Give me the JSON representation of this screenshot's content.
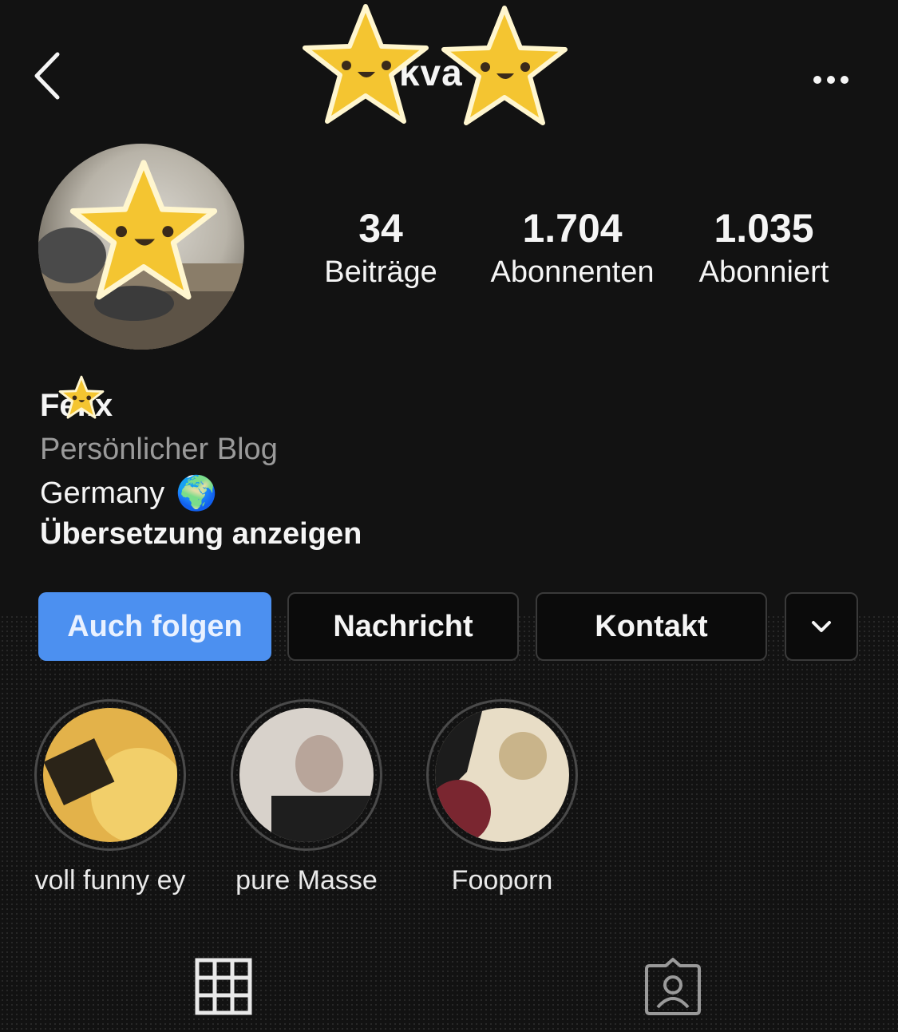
{
  "header": {
    "username": "kva s",
    "back_icon": "chevron-left-icon",
    "more_icon": "ellipsis-icon"
  },
  "stats": [
    {
      "value": "34",
      "label": "Beiträge"
    },
    {
      "value": "1.704",
      "label": "Abonnenten"
    },
    {
      "value": "1.035",
      "label": "Abonniert"
    }
  ],
  "bio": {
    "name": "Felix",
    "category": "Persönlicher Blog",
    "location": "Germany",
    "location_emoji": "🌍",
    "translate_link": "Übersetzung anzeigen"
  },
  "actions": {
    "follow": "Auch folgen",
    "message": "Nachricht",
    "contact": "Kontakt"
  },
  "highlights": [
    {
      "label": "voll funny ey"
    },
    {
      "label": "pure Masse"
    },
    {
      "label": "Fooporn"
    }
  ],
  "tabs": [
    {
      "icon": "grid-icon"
    },
    {
      "icon": "tagged-user-icon"
    }
  ],
  "colors": {
    "background": "#121212",
    "follow_button": "#4c90f0",
    "secondary_text": "#9a9a9a"
  }
}
